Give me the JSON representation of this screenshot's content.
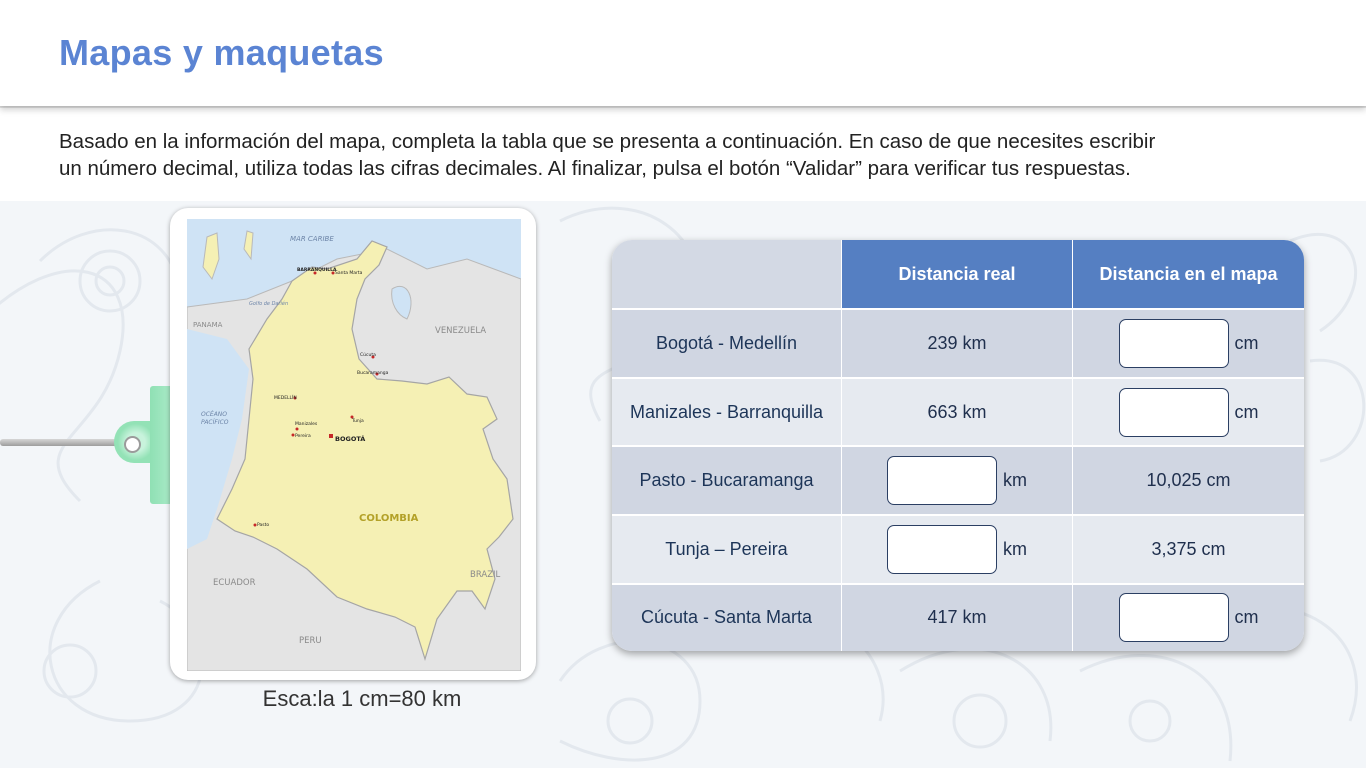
{
  "page": {
    "title": "Mapas y maquetas"
  },
  "instructions": {
    "line1": "Basado en la información del mapa, completa la tabla que se presenta a continuación. En caso de que necesites escribir",
    "line2": "un número decimal, utiliza todas las cifras decimales. Al finalizar, pulsa el botón “Validar” para verificar tus respuestas."
  },
  "map": {
    "labels": {
      "sea": "MAR CARIBE",
      "gulf": "Golfo de Darién",
      "ocean": "OCÉANO PACÍFICO",
      "ocean_line1": "OCÉANO",
      "ocean_line2": "PACÍFICO",
      "panama": "PANAMA",
      "venezuela": "VENEZUELA",
      "ecuador": "ECUADOR",
      "brazil": "BRAZIL",
      "peru": "PERU",
      "colombia": "COLOMBIA"
    },
    "cities": {
      "barranquilla": "BARRANQUILLA",
      "santa_marta": "Santa Marta",
      "cucuta": "Cúcuta",
      "bucaramanga": "Bucaramanga",
      "medellin": "MEDELLÍN",
      "tunja": "Tunja",
      "manizales": "Manizales",
      "pereira": "Pereira",
      "bogota": "BOGOTÁ",
      "pasto": "Pasto"
    },
    "scale_caption": "Esca:la 1 cm=80 km"
  },
  "table": {
    "headers": [
      "",
      "Distancia real",
      "Distancia en el mapa"
    ],
    "rows": [
      {
        "route": "Bogotá - Medellín",
        "real": "239 km",
        "real_unit": "",
        "map": "",
        "map_unit": "cm"
      },
      {
        "route": "Manizales - Barranquilla",
        "real": "663 km",
        "real_unit": "",
        "map": "",
        "map_unit": "cm"
      },
      {
        "route": "Pasto - Bucaramanga",
        "real": "",
        "real_unit": "km",
        "map": "10,025 cm",
        "map_unit": ""
      },
      {
        "route": "Tunja – Pereira",
        "real": "",
        "real_unit": "km",
        "map": "3,375 cm",
        "map_unit": ""
      },
      {
        "route": "Cúcuta - Santa Marta",
        "real": "417 km",
        "real_unit": "",
        "map": "",
        "map_unit": "cm"
      }
    ]
  },
  "colors": {
    "title": "#5b84d3",
    "header_blue": "#557fc2",
    "row_dark": "#d0d6e2",
    "row_light": "#e6eaf0",
    "colombia_fill": "#f5f0b4",
    "water": "#cfe3f5",
    "land_other": "#e4e4e4",
    "clip_green": "#8fe0b4"
  }
}
